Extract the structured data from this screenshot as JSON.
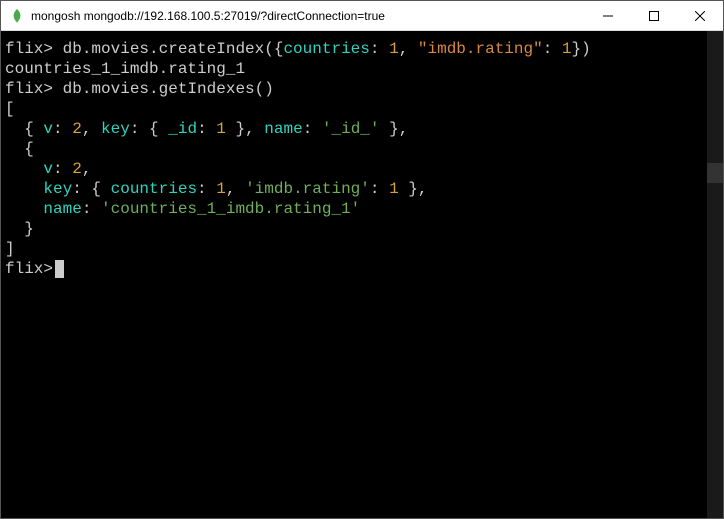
{
  "titlebar": {
    "title": "mongosh mongodb://192.168.100.5:27019/?directConnection=true"
  },
  "terminal": {
    "prompt": "flix>",
    "cmd1_pre": " db.movies.createIndex({",
    "cmd1_k1": "countries",
    "cmd1_sep1": ": ",
    "cmd1_v1": "1",
    "cmd1_comma": ", ",
    "cmd1_k2": "\"imdb.rating\"",
    "cmd1_sep2": ": ",
    "cmd1_v2": "1",
    "cmd1_post": "})",
    "res1": "countries_1_imdb.rating_1",
    "cmd2": " db.movies.getIndexes()",
    "arr_open": "[",
    "obj1_pre": "  { ",
    "obj1_vlab": "v",
    "obj1_vsep": ": ",
    "obj1_vval": "2",
    "obj1_c1": ", ",
    "obj1_klab": "key",
    "obj1_ksep": ": { ",
    "obj1_idlab": "_id",
    "obj1_idsep": ": ",
    "obj1_idval": "1",
    "obj1_kclose": " }, ",
    "obj1_nlab": "name",
    "obj1_nsep": ": ",
    "obj1_nval": "'_id_'",
    "obj1_post": " },",
    "obj2_open": "  {",
    "obj2_vline_pre": "    ",
    "obj2_vlab": "v",
    "obj2_vsep": ": ",
    "obj2_vval": "2",
    "obj2_vend": ",",
    "obj2_kline_pre": "    ",
    "obj2_klab": "key",
    "obj2_ksep": ": { ",
    "obj2_countrieslab": "countries",
    "obj2_countriessep": ": ",
    "obj2_countriesval": "1",
    "obj2_kcomma": ", ",
    "obj2_imdblab": "'imdb.rating'",
    "obj2_imdbsep": ": ",
    "obj2_imdbval": "1",
    "obj2_kclose": " },",
    "obj2_nline_pre": "    ",
    "obj2_nlab": "name",
    "obj2_nsep": ": ",
    "obj2_nval": "'countries_1_imdb.rating_1'",
    "obj2_close": "  }",
    "arr_close": "]"
  }
}
